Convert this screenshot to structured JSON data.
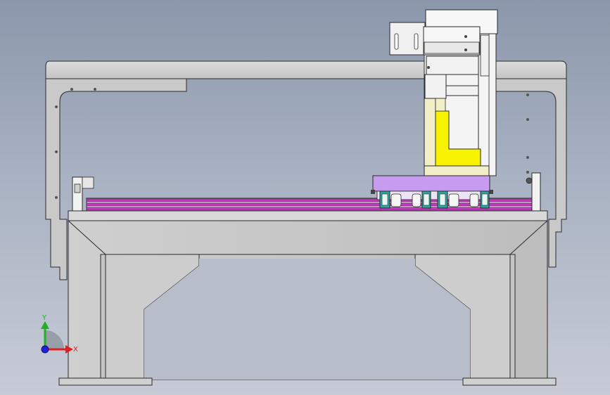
{
  "viewport": {
    "background": "gradient-grey-blue"
  },
  "triad": {
    "x_label": "X",
    "y_label": "Y",
    "x_color": "#e02020",
    "y_color": "#20b020",
    "z_color": "#2020e0"
  },
  "colors": {
    "frame_grey": "#d6d6d6",
    "outline": "#2a2a2a",
    "rail_magenta": "#c23bbf",
    "carriage_violet": "#c79cf0",
    "bracket_yellow": "#f7f200",
    "block_cream": "#f2efc8",
    "bearing_teal": "#2aa7a0"
  }
}
